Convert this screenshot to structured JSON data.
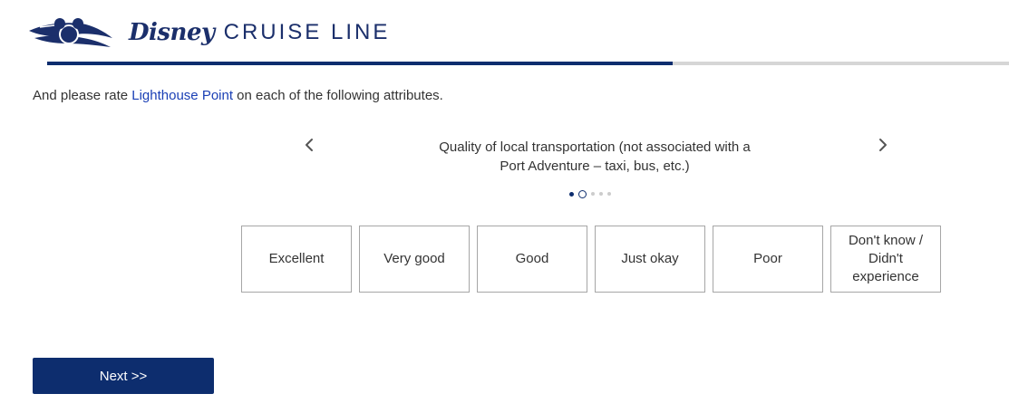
{
  "brand": {
    "logo_icon": "mickey-ship-logo-icon",
    "wordmark_disney": "Disney",
    "wordmark_rest": "CRUISE LINE",
    "color": "#1b2f6b"
  },
  "progress": {
    "fraction": 0.65,
    "fill_color": "#0d2d6e",
    "track_color": "#d6d6d6"
  },
  "question": {
    "prefix": "And please rate ",
    "link": "Lighthouse Point",
    "suffix": " on each of the following attributes."
  },
  "carousel": {
    "prev_icon": "chevron-left-icon",
    "next_icon": "chevron-right-icon",
    "attribute_line1": "Quality of local transportation (not associated with a",
    "attribute_line2": "Port Adventure – taxi, bus, etc.)",
    "pagination": {
      "total": 5,
      "current": 2
    }
  },
  "options": [
    {
      "label": "Excellent"
    },
    {
      "label": "Very good"
    },
    {
      "label": "Good"
    },
    {
      "label": "Just okay"
    },
    {
      "label": "Poor"
    },
    {
      "label_lines": [
        "Don't know /",
        "Didn't",
        "experience"
      ]
    }
  ],
  "next_button": {
    "label": "Next  >>"
  },
  "colors": {
    "navy": "#0d2d6e",
    "link": "#1a3fb5"
  }
}
